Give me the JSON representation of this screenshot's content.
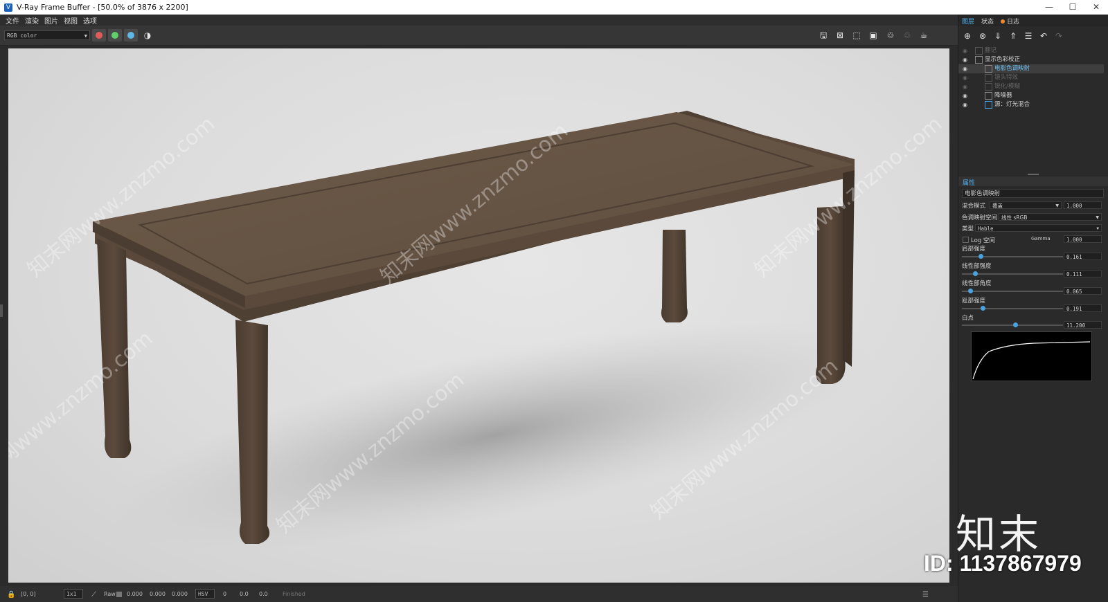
{
  "window": {
    "title": "V-Ray Frame Buffer - [50.0% of 3876 x 2200]",
    "controls": [
      "—",
      "☐",
      "✕"
    ]
  },
  "menu": [
    "文件",
    "渲染",
    "图片",
    "视图",
    "选项"
  ],
  "toolbar": {
    "channel": "RGB color",
    "channel_colors": {
      "red": "#e25b5b",
      "green": "#5fcf6a",
      "blue": "#5fb7e8"
    }
  },
  "status": {
    "coords": "[0, 0]",
    "zoom": "1x1",
    "mode": "Raw",
    "r": "0.000",
    "g": "0.000",
    "b": "0.000",
    "colorspace": "HSV",
    "h": "0",
    "s": "0.0",
    "v": "0.0",
    "state": "Finished"
  },
  "panel": {
    "tabs": [
      "图层",
      "状态",
      "日志"
    ],
    "layers": [
      {
        "label": "翻记",
        "dim": true,
        "indent": 0
      },
      {
        "label": "显示色彩校正",
        "dim": false,
        "indent": 0
      },
      {
        "label": "电影色调映射",
        "dim": false,
        "indent": 1,
        "selected": true
      },
      {
        "label": "镜头特效",
        "dim": true,
        "indent": 1
      },
      {
        "label": "锐化/模糊",
        "dim": true,
        "indent": 1
      },
      {
        "label": "降噪器",
        "dim": false,
        "indent": 1
      },
      {
        "label": "源：灯光混合",
        "dim": false,
        "indent": 1
      }
    ],
    "props_header": "属性",
    "props_title": "电影色调映射",
    "blend_mode_label": "混合模式",
    "blend_mode_value": "覆盖",
    "blend_amount": "1.000",
    "tone_space_label": "色调映射空间",
    "tone_space_value": "线性 sRGB",
    "type_label": "类型",
    "type_value": "Hable",
    "log_label": "Log 空间",
    "gamma_label": "Gamma",
    "gamma_value": "1.000",
    "sliders": [
      {
        "label": "肩部强度",
        "value": "0.161",
        "level": 0.16
      },
      {
        "label": "线性部强度",
        "value": "0.111",
        "level": 0.11
      },
      {
        "label": "线性部角度",
        "value": "0.065",
        "level": 0.07
      },
      {
        "label": "趾部强度",
        "value": "0.191",
        "level": 0.19
      },
      {
        "label": "白点",
        "value": "11.200",
        "level": 0.53
      }
    ]
  },
  "watermark": {
    "logo": "知末",
    "id": "ID: 1137867979",
    "text": "知末网www.znzmo.com"
  }
}
